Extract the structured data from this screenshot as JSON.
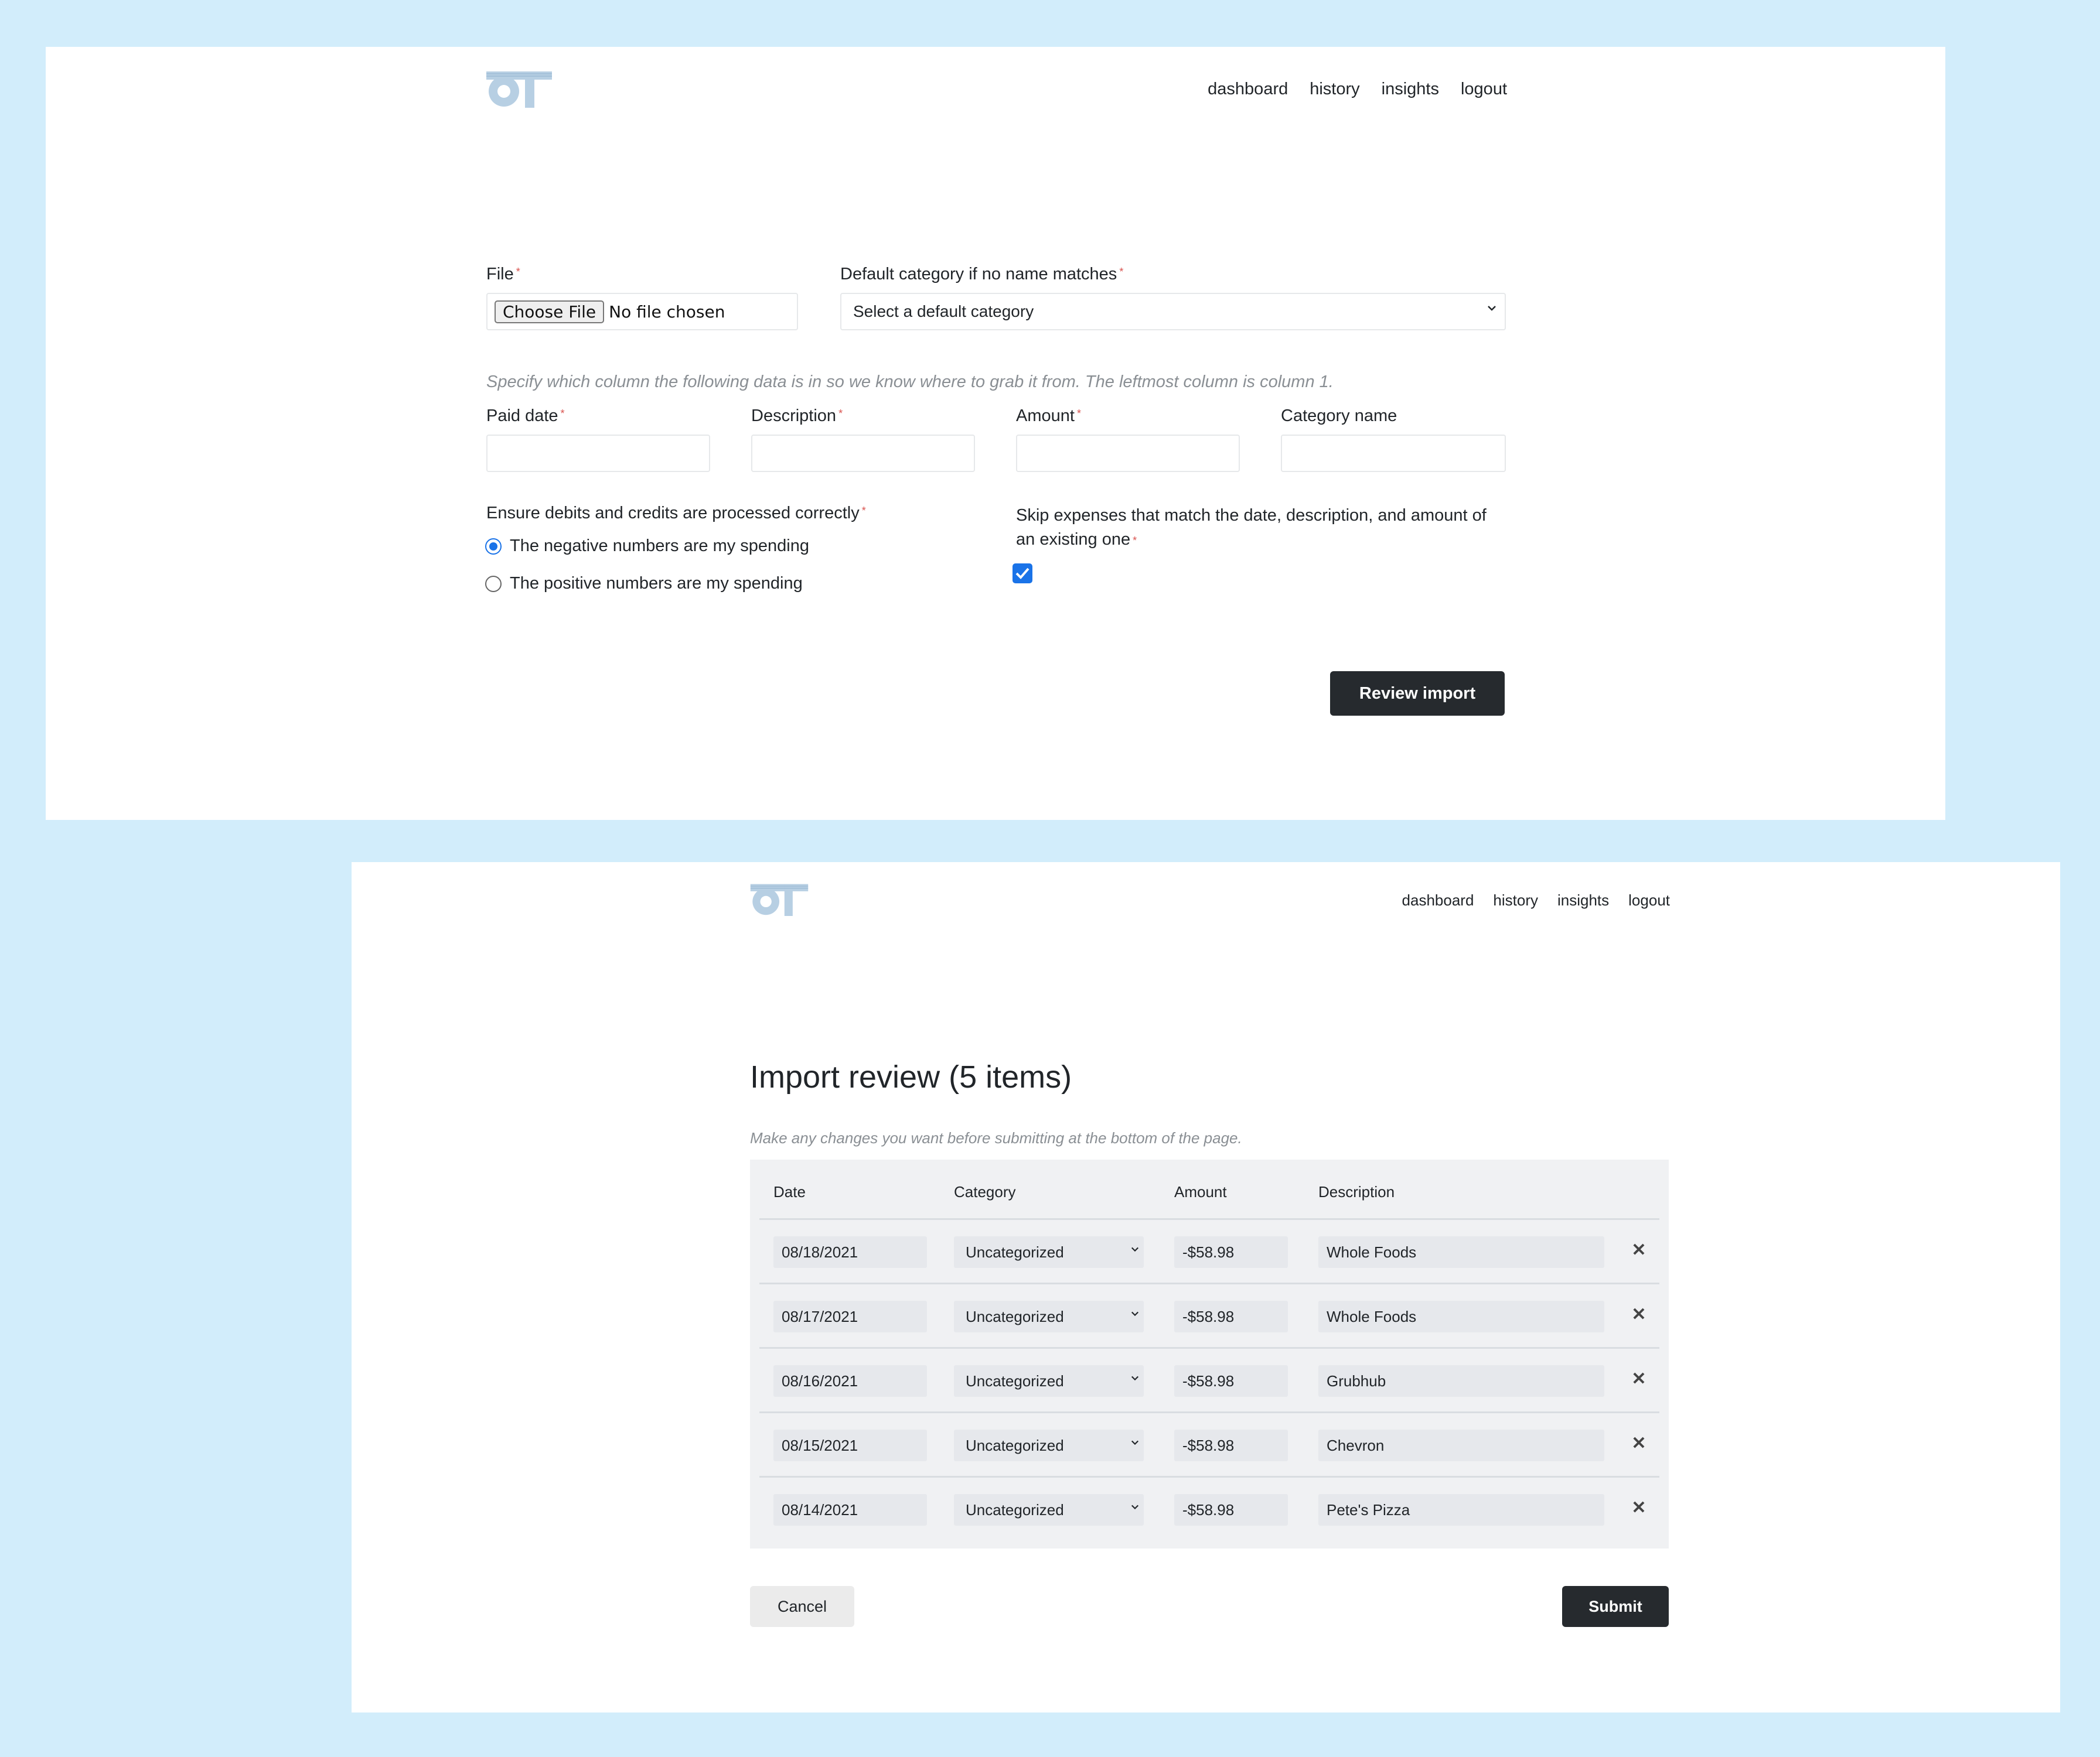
{
  "colors": {
    "page_background": "#d2edfb",
    "panel_background": "#ffffff",
    "primary_button": "#262a2e",
    "required_marker": "#d9534f",
    "accent": "#1a73e8",
    "logo": "#b7cfe3"
  },
  "logo": {
    "text": "OT"
  },
  "nav": {
    "items": [
      "dashboard",
      "history",
      "insights",
      "logout"
    ]
  },
  "import_form": {
    "file": {
      "label": "File",
      "required_mark": "*",
      "button_label": "Choose File",
      "status": "No file chosen"
    },
    "default_category": {
      "label": "Default category if no name matches",
      "required_mark": "*",
      "placeholder": "Select a default category",
      "icon": "chevron-down-icon"
    },
    "column_hint": "Specify which column the following data is in so we know where to grab it from. The leftmost column is column 1.",
    "columns": {
      "paid_date": {
        "label": "Paid date",
        "required_mark": "*",
        "value": ""
      },
      "description": {
        "label": "Description",
        "required_mark": "*",
        "value": ""
      },
      "amount": {
        "label": "Amount",
        "required_mark": "*",
        "value": ""
      },
      "category_name": {
        "label": "Category name",
        "value": ""
      }
    },
    "debit_credit": {
      "label": "Ensure debits and credits are processed correctly",
      "required_mark": "*",
      "options": [
        {
          "label": "The negative numbers are my spending",
          "selected": true
        },
        {
          "label": "The positive numbers are my spending",
          "selected": false
        }
      ]
    },
    "skip_duplicates": {
      "label_line1": "Skip expenses that match the date, description, and amount of",
      "label_line2": "an existing one",
      "required_mark": "*",
      "checked": true
    },
    "review_button": "Review import"
  },
  "import_review": {
    "title": "Import review (5 items)",
    "subtitle": "Make any changes you want before submitting at the bottom of the page.",
    "columns": [
      "Date",
      "Category",
      "Amount",
      "Description"
    ],
    "rows": [
      {
        "date": "08/18/2021",
        "category": "Uncategorized",
        "amount": "-$58.98",
        "description": "Whole Foods"
      },
      {
        "date": "08/17/2021",
        "category": "Uncategorized",
        "amount": "-$58.98",
        "description": "Whole Foods"
      },
      {
        "date": "08/16/2021",
        "category": "Uncategorized",
        "amount": "-$58.98",
        "description": "Grubhub"
      },
      {
        "date": "08/15/2021",
        "category": "Uncategorized",
        "amount": "-$58.98",
        "description": "Chevron"
      },
      {
        "date": "08/14/2021",
        "category": "Uncategorized",
        "amount": "-$58.98",
        "description": "Pete's Pizza"
      }
    ],
    "row_remove_icon": "close-icon",
    "cancel_button": "Cancel",
    "submit_button": "Submit"
  }
}
